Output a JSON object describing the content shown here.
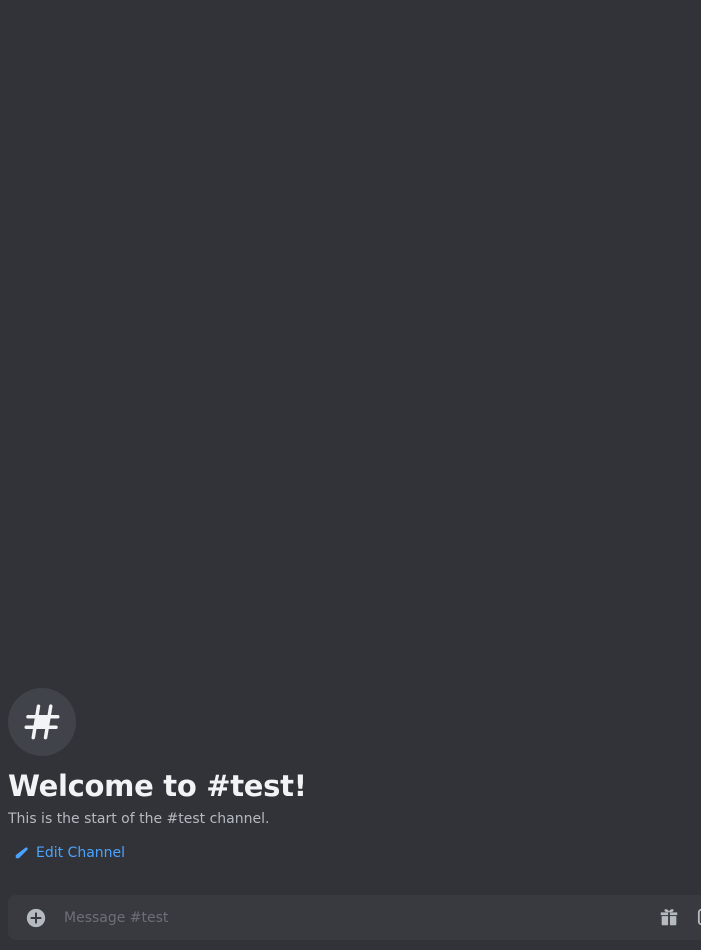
{
  "channel": {
    "name": "#test",
    "welcome_title": "Welcome to #test!",
    "welcome_subtitle": "This is the start of the #test channel.",
    "edit_label": "Edit Channel"
  },
  "composer": {
    "placeholder": "Message #test"
  },
  "icons": {
    "channel": "hash-icon",
    "edit": "pencil-icon",
    "attach": "plus-circle-icon",
    "gift": "gift-icon",
    "extra": "gif-icon"
  },
  "colors": {
    "background": "#313338",
    "accent_link": "#4aa3ff",
    "composer_bg": "#383a40"
  }
}
